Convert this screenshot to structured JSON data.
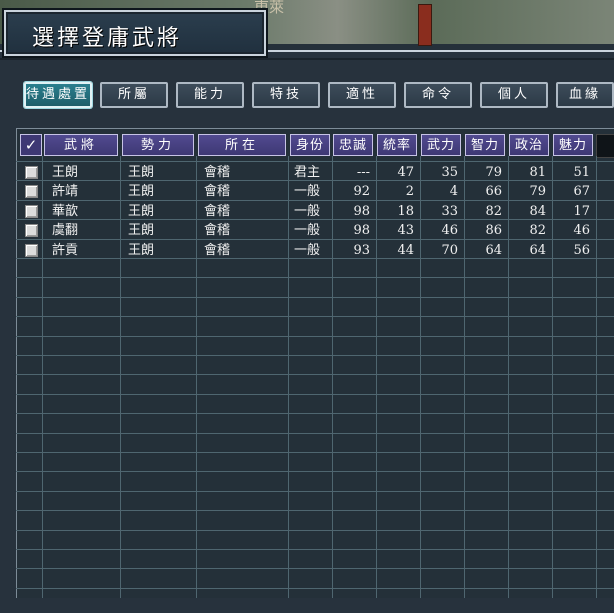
{
  "background": {
    "city_label": "東萊"
  },
  "window": {
    "title": "選擇登庸武將"
  },
  "tabs": [
    {
      "label": "待遇處置",
      "active": true
    },
    {
      "label": "所屬",
      "active": false
    },
    {
      "label": "能力",
      "active": false
    },
    {
      "label": "特技",
      "active": false
    },
    {
      "label": "適性",
      "active": false
    },
    {
      "label": "命令",
      "active": false
    },
    {
      "label": "個人",
      "active": false
    },
    {
      "label": "血緣",
      "active": false
    }
  ],
  "table": {
    "check_header": "✓",
    "headers": {
      "name": "武將",
      "force": "勢力",
      "location": "所在",
      "rank": "身份",
      "loyalty": "忠誠",
      "leadership": "統率",
      "war": "武力",
      "intelligence": "智力",
      "politics": "政治",
      "charisma": "魅力"
    },
    "rows": [
      {
        "name": "王朗",
        "force": "王朗",
        "location": "會稽",
        "rank": "君主",
        "loyalty": "---",
        "leadership": "47",
        "war": "35",
        "intelligence": "79",
        "politics": "81",
        "charisma": "51"
      },
      {
        "name": "許靖",
        "force": "王朗",
        "location": "會稽",
        "rank": "一般",
        "loyalty": "92",
        "leadership": "2",
        "war": "4",
        "intelligence": "66",
        "politics": "79",
        "charisma": "67"
      },
      {
        "name": "華歆",
        "force": "王朗",
        "location": "會稽",
        "rank": "一般",
        "loyalty": "98",
        "leadership": "18",
        "war": "33",
        "intelligence": "82",
        "politics": "84",
        "charisma": "17"
      },
      {
        "name": "虞翻",
        "force": "王朗",
        "location": "會稽",
        "rank": "一般",
        "loyalty": "98",
        "leadership": "43",
        "war": "46",
        "intelligence": "86",
        "politics": "82",
        "charisma": "46"
      },
      {
        "name": "許貢",
        "force": "王朗",
        "location": "會稽",
        "rank": "一般",
        "loyalty": "93",
        "leadership": "44",
        "war": "70",
        "intelligence": "64",
        "politics": "64",
        "charisma": "56"
      }
    ]
  }
}
